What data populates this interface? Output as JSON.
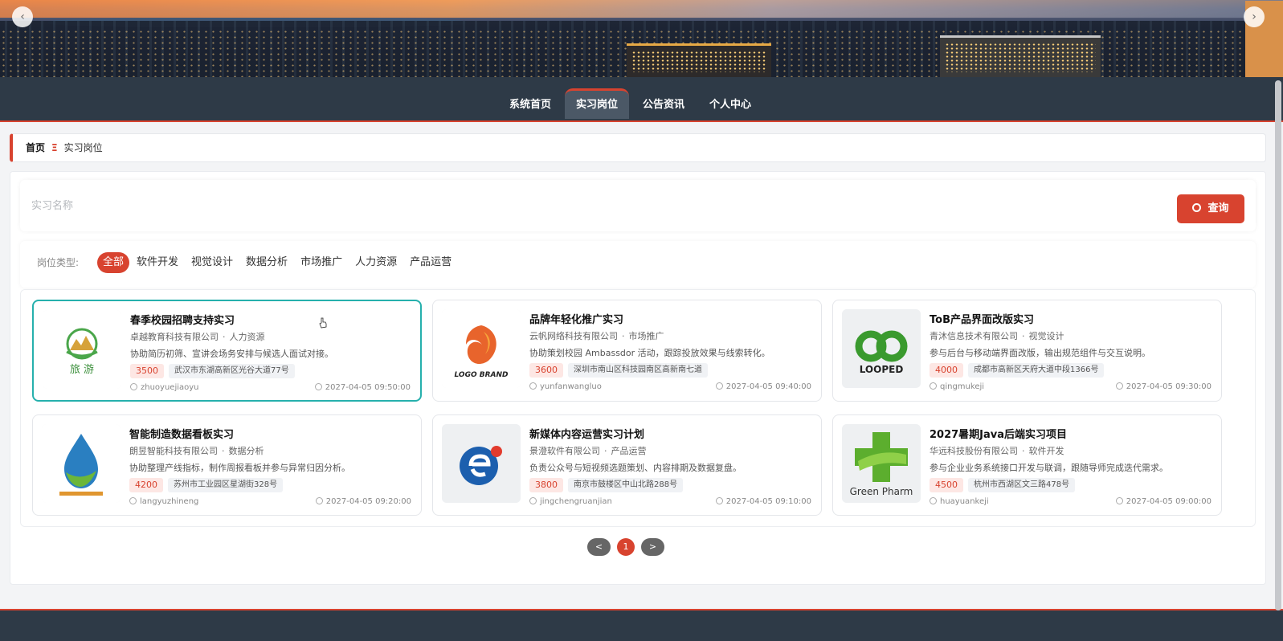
{
  "carousel": {
    "prev": "‹",
    "next": "›"
  },
  "nav": {
    "items": [
      "系统首页",
      "实习岗位",
      "公告资讯",
      "个人中心"
    ],
    "active_index": 1
  },
  "breadcrumb": {
    "home": "首页",
    "separator": "Ξ",
    "current": "实习岗位"
  },
  "search": {
    "placeholder": "实习名称",
    "value": "",
    "button": "查询"
  },
  "filter": {
    "label": "岗位类型:",
    "options": [
      "全部",
      "软件开发",
      "视觉设计",
      "数据分析",
      "市场推广",
      "人力资源",
      "产品运营"
    ],
    "active_index": 0
  },
  "cards": [
    {
      "title": "春季校园招聘支持实习",
      "company": "卓越教育科技有限公司",
      "category": "人力资源",
      "desc": "协助简历初筛、宣讲会场务安排与候选人面试对接。",
      "salary": "3500",
      "address": "武汉市东湖高新区光谷大道77号",
      "user": "zhuoyuejiaoyu",
      "time": "2027-04-05 09:50:00",
      "logo": "travel-logo",
      "logo_text": "旅 游"
    },
    {
      "title": "品牌年轻化推广实习",
      "company": "云帆网络科技有限公司",
      "category": "市场推广",
      "desc": "协助策划校园 Ambassdor 活动，跟踪投放效果与线索转化。",
      "salary": "3600",
      "address": "深圳市南山区科技园南区高新南七道",
      "user": "yunfanwangluo",
      "time": "2027-04-05 09:40:00",
      "logo": "logo-brand-logo",
      "logo_text": "LOGO BRAND"
    },
    {
      "title": "ToB产品界面改版实习",
      "company": "青沐信息技术有限公司",
      "category": "视觉设计",
      "desc": "参与后台与移动端界面改版，输出规范组件与交互说明。",
      "salary": "4000",
      "address": "成都市高新区天府大道中段1366号",
      "user": "qingmukeji",
      "time": "2027-04-05 09:30:00",
      "logo": "looped-logo",
      "logo_text": "LOOPED"
    },
    {
      "title": "智能制造数据看板实习",
      "company": "朗昱智能科技有限公司",
      "category": "数据分析",
      "desc": "协助整理产线指标，制作周报看板并参与异常归因分析。",
      "salary": "4200",
      "address": "苏州市工业园区星湖街328号",
      "user": "langyuzhineng",
      "time": "2027-04-05 09:20:00",
      "logo": "water-drop-logo",
      "logo_text": ""
    },
    {
      "title": "新媒体内容运营实习计划",
      "company": "景澄软件有限公司",
      "category": "产品运营",
      "desc": "负责公众号与短视频选题策划、内容排期及数据复盘。",
      "salary": "3800",
      "address": "南京市鼓楼区中山北路288号",
      "user": "jingchengruanjian",
      "time": "2027-04-05 09:10:00",
      "logo": "e-circle-logo",
      "logo_text": ""
    },
    {
      "title": "2027暑期Java后端实习项目",
      "company": "华远科技股份有限公司",
      "category": "软件开发",
      "desc": "参与企业业务系统接口开发与联调，跟随导师完成迭代需求。",
      "salary": "4500",
      "address": "杭州市西湖区文三路478号",
      "user": "huayuankeji",
      "time": "2027-04-05 09:00:00",
      "logo": "green-cross-logo",
      "logo_text": "Green Pharm"
    }
  ],
  "pager": {
    "prev": "<",
    "current": "1",
    "next": ">"
  }
}
